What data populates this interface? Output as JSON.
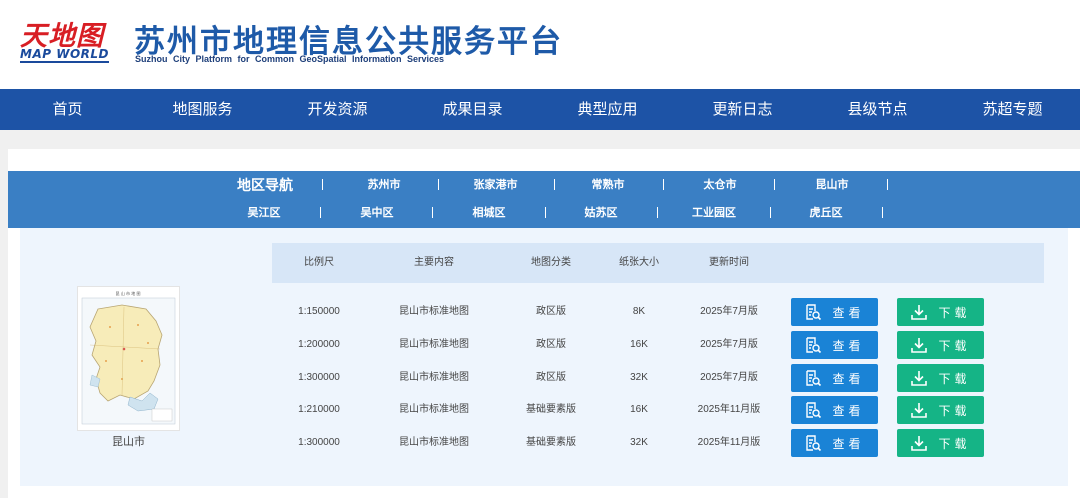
{
  "header": {
    "logo_cn": "天地图",
    "logo_en": "MAP WORLD",
    "title": "苏州市地理信息公共服务平台",
    "subtitle": "Suzhou City Platform for Common GeoSpatial Information Services"
  },
  "nav": [
    "首页",
    "地图服务",
    "开发资源",
    "成果目录",
    "典型应用",
    "更新日志",
    "县级节点",
    "苏超专题"
  ],
  "region_nav": {
    "title": "地区导航",
    "row1": [
      "苏州市",
      "张家港市",
      "常熟市",
      "太仓市",
      "昆山市"
    ],
    "row2": [
      "吴江区",
      "吴中区",
      "相城区",
      "姑苏区",
      "工业园区",
      "虎丘区"
    ]
  },
  "map_thumb": {
    "header_text": "昆 山 市 地 图",
    "label": "昆山市"
  },
  "table": {
    "headers": [
      "比例尺",
      "主要内容",
      "地图分类",
      "纸张大小",
      "更新时间"
    ],
    "view_label": "查看",
    "download_label": "下载",
    "rows": [
      {
        "scale": "1:150000",
        "content": "昆山市标准地图",
        "category": "政区版",
        "paper": "8K",
        "updated": "2025年7月版"
      },
      {
        "scale": "1:200000",
        "content": "昆山市标准地图",
        "category": "政区版",
        "paper": "16K",
        "updated": "2025年7月版"
      },
      {
        "scale": "1:300000",
        "content": "昆山市标准地图",
        "category": "政区版",
        "paper": "32K",
        "updated": "2025年7月版"
      },
      {
        "scale": "1:210000",
        "content": "昆山市标准地图",
        "category": "基础要素版",
        "paper": "16K",
        "updated": "2025年11月版"
      },
      {
        "scale": "1:300000",
        "content": "昆山市标准地图",
        "category": "基础要素版",
        "paper": "32K",
        "updated": "2025年11月版"
      }
    ]
  },
  "colors": {
    "nav_bg": "#1d53a6",
    "region_bg": "#3a7fc4",
    "view_button": "#1a83d6",
    "download_button": "#15b486",
    "title": "#1e5aa8"
  },
  "icons": {
    "view": "search-document-icon",
    "download": "download-icon"
  }
}
